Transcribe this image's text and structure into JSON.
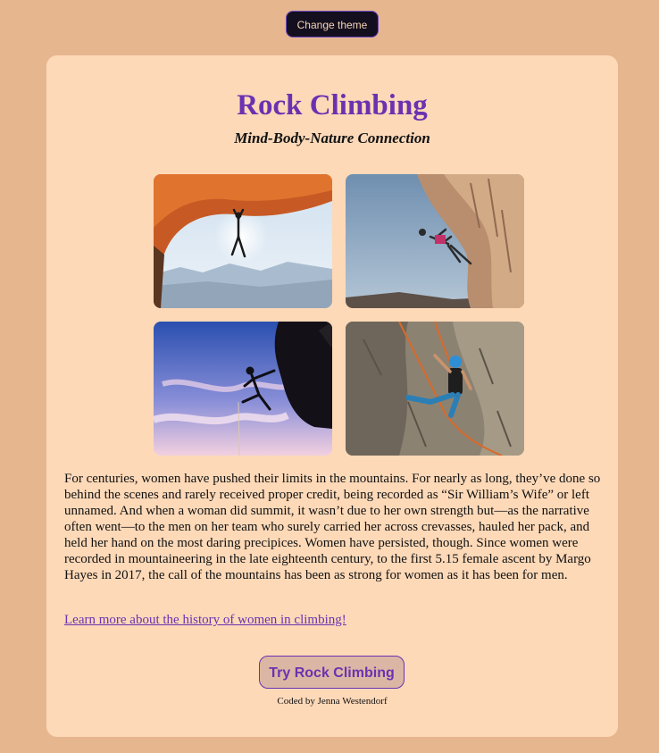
{
  "header": {
    "theme_button": "Change theme"
  },
  "card": {
    "title": "Rock Climbing",
    "subtitle": "Mind-Body-Nature Connection",
    "body": "For centuries, women have pushed their limits in the mountains. For nearly as long, they’ve done so behind the scenes and rarely received proper credit, being recorded as “Sir William’s Wife” or left unnamed. And when a woman did summit, it wasn’t due to her own strength but—as the narrative often went—to the men on her team who surely carried her across crevasses, hauled her pack, and held her hand on the most daring precipices. Women have persisted, though. Since women were recorded in mountaineering in the late eighteenth century, to the first 5.15 female ascent by Margo Hayes in 2017, the call of the mountains has been as strong for women as it has been for men.",
    "link": "Learn more about the history of women in climbing!",
    "cta": "Try Rock Climbing",
    "credit": "Coded by Jenna Westendorf"
  },
  "colors": {
    "page_bg": "#e6b68f",
    "card_bg": "#fdd9b8",
    "accent": "#6a32b0",
    "dark_button": "#140f1f"
  }
}
